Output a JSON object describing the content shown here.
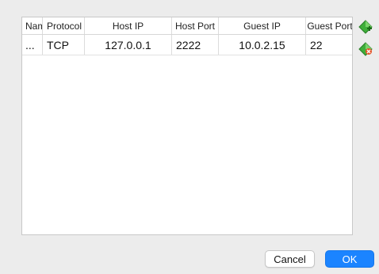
{
  "table": {
    "columns": {
      "name": "Name",
      "protocol": "Protocol",
      "host_ip": "Host IP",
      "host_port": "Host Port",
      "guest_ip": "Guest IP",
      "guest_port": "Guest Port"
    },
    "rows": [
      {
        "name": "...",
        "protocol": "TCP",
        "host_ip": "127.0.0.1",
        "host_port": "2222",
        "guest_ip": "10.0.2.15",
        "guest_port": "22"
      }
    ]
  },
  "side_buttons": {
    "add_icon": "add-rule-icon",
    "remove_icon": "remove-rule-icon"
  },
  "buttons": {
    "cancel": "Cancel",
    "ok": "OK"
  },
  "colors": {
    "accent": "#1b84ff"
  }
}
